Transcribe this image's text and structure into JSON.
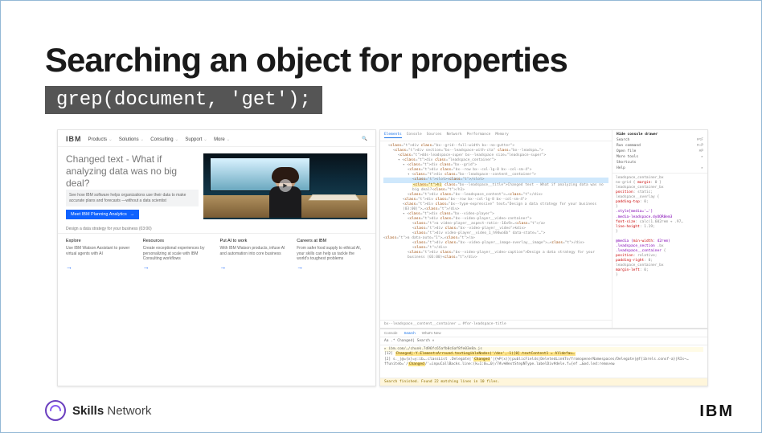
{
  "slide": {
    "title": "Searching an object for properties",
    "code": "grep(document, 'get');"
  },
  "browser": {
    "logo": "IBM",
    "nav": [
      "Products",
      "Solutions",
      "Consulting",
      "Support",
      "More"
    ],
    "headline": "Changed text - What if analyzing data was no big deal?",
    "promo": "See how IBM software helps organizations use their data to make accurate plans and forecasts —without a data scientist",
    "cta": "Meet IBM Planning Analytics",
    "caption": "Design a data strategy for your business (03:00)",
    "tiles": [
      {
        "h": "Explore",
        "b": "Use IBM Watson Assistant to power virtual agents with AI"
      },
      {
        "h": "Resources",
        "b": "Create exceptional experiences by personalizing at scale with IBM Consulting workflows"
      },
      {
        "h": "Put AI to work",
        "b": "With IBM Watson products, infuse AI and automation into core business"
      },
      {
        "h": "Careers at IBM",
        "b": "From safer food supply to ethical AI, your skills can help us tackle the world's toughest problems"
      }
    ]
  },
  "devtools": {
    "tabs": [
      "Elements",
      "Console",
      "Sources",
      "Network",
      "Performance",
      "Memory"
    ],
    "dom_lines": [
      {
        "i": 1,
        "html": "<div class=\"bx--grid--full-width bx--no-gutter\">"
      },
      {
        "i": 2,
        "html": "<div section=\"bx--leadspace-with-cta\" class=\"bx--leadspa…\">"
      },
      {
        "i": 3,
        "html": "<dds-leadspace-super bx--leadspace size=\"leadspace-super\">"
      },
      {
        "i": 3,
        "html": "▾ <div class=\"leadspace_container\">"
      },
      {
        "i": 4,
        "html": "▾ <div class=\"bx--grid\">"
      },
      {
        "i": 5,
        "html": "<div class=\"bx--row bx--col-lg-8 bx--col-sm-4\">"
      },
      {
        "i": 5,
        "html": "▾ <div class=\"bx--leadspace--content__container\">"
      },
      {
        "i": 6,
        "html": "<slot></slot>",
        "hl": true
      },
      {
        "i": 6,
        "html": "<h1 class=\"bx--leadspace__title\">Changed text - What if analyzing data was no big deal?</h1>",
        "ht": true
      },
      {
        "i": 5,
        "html": "<div class=\"bx--leadspace_content\">…</div>"
      },
      {
        "i": 4,
        "html": "<div class=\"bx--row bx--col-lg-8 bx--col-sm-4\">"
      },
      {
        "i": 4,
        "html": "<div class=\"bx--type-expressive\" text=\"Design a data strategy for your business (03:00)\">…</div>"
      },
      {
        "i": 4,
        "html": "▾ <div class=\"bx--video-player\">"
      },
      {
        "i": 5,
        "html": "<div class=\"bx--video-player__video-container\">"
      },
      {
        "i": 6,
        "html": "<a video-player__aspect-ratio--16x9>…</a>"
      },
      {
        "i": 6,
        "html": "<div class=\"bx--video-player__video\">kdiv>"
      },
      {
        "i": 6,
        "html": "<div video-player__video_1_h94wo6b\" data-state=\"…\">"
      },
      {
        "i": 7,
        "html": "<a data-auto=\"1\">…</a>"
      },
      {
        "i": 6,
        "html": "<div class=\"bx--video-player__image-overlay__image\">…</div>"
      },
      {
        "i": 6,
        "html": "</div>"
      },
      {
        "i": 5,
        "html": "<div class=\"bx--video-player__video-caption\">Design a data strategy for your business (03:00)</div>"
      }
    ],
    "menu": {
      "header": "Hide console drawer",
      "items": [
        {
          "l": "Search",
          "k": "⌘⌥F"
        },
        {
          "l": "Run command",
          "k": "⌘⇧P"
        },
        {
          "l": "Open file",
          "k": "⌘P"
        },
        {
          "l": "More tools",
          "k": "▸"
        },
        {
          "l": "Shortcuts",
          "k": ""
        },
        {
          "l": "Help",
          "k": "▸"
        }
      ]
    },
    "styles": [
      "leadspace_container_bx",
      "no-grid { margin: 0 }",
      "leadspace_container_bx",
      "  position: static;",
      "  leadspace__overlay {",
      "  padding-top: 0;",
      "}",
      ".style[media='…']",
      ".media-leadspace.dyUQR0em3",
      "  font-size: calc(1.602rem + .97…",
      "  line-height: 1.19;",
      "}",
      "",
      "@media (min-width: 42rem)",
      ".leadspace_section .bx",
      ".leadspace__container {",
      "  position: relative;",
      "  padding-right: 0;",
      "  leadspace_container_bx",
      "  margin-left: 0;",
      "}"
    ],
    "crumb": "bx--leadspace__content__container … #for-leadspace-title",
    "console_tabs": [
      "Console",
      "Search",
      "What's New"
    ],
    "search_label": "Aa .* Changed|   Search  ×",
    "console_lines": [
      {
        "yel": true,
        "txt": "▸ ibm.com/…/chunk.7d96fc65afb0c6af8fe03e8a.js"
      },
      {
        "txt": "[12] <h1|Dds-leadspace:nth::shadowRoot::Changed|-Y.ElementsArround.textLegibleNodes('/des',-1)[0].textContent1 = Alldefau…"
      },
      {
        "txt": "[2] s._|@={x}=y:ib….classList .Delegate|'Changed'|{%P(x)}|publicFields|DeletedLinkTo/fromopenerNamespaces/Delegate|@f{ibrels.consf-a}|RIs~…"
      },
      {
        "txt": "    ffuniteb='/Changed/'=inpuCallBacks.line:(k=1:0=…0)/7#=%NextStepNType.labelDiv#dele.f={ef …&od.led:removeω"
      }
    ],
    "status": "Search finished. Found 22 matching lines in 10 files."
  },
  "footer": {
    "brand": "Skills",
    "brand2": "Network",
    "ibm": "IBM"
  }
}
